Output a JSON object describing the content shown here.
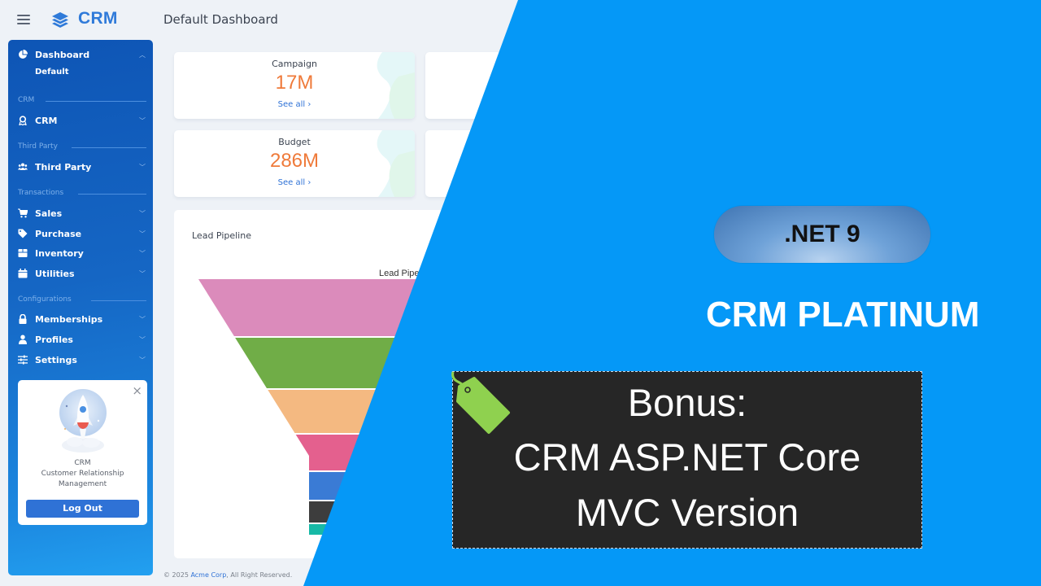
{
  "header": {
    "brand": "CRM",
    "page_title": "Default Dashboard"
  },
  "sidebar": {
    "dashboard": {
      "label": "Dashboard",
      "icon": "chart-pie-icon",
      "sub_items": [
        "Default"
      ]
    },
    "sections": [
      {
        "title": "CRM",
        "items": [
          {
            "label": "CRM",
            "icon": "award-icon"
          }
        ]
      },
      {
        "title": "Third Party",
        "items": [
          {
            "label": "Third Party",
            "icon": "users-icon"
          }
        ]
      },
      {
        "title": "Transactions",
        "items": [
          {
            "label": "Sales",
            "icon": "cart-icon"
          },
          {
            "label": "Purchase",
            "icon": "tag-icon"
          },
          {
            "label": "Inventory",
            "icon": "box-icon"
          },
          {
            "label": "Utilities",
            "icon": "calendar-icon"
          }
        ]
      },
      {
        "title": "Configurations",
        "items": [
          {
            "label": "Memberships",
            "icon": "lock-icon"
          },
          {
            "label": "Profiles",
            "icon": "user-icon"
          },
          {
            "label": "Settings",
            "icon": "sliders-icon"
          }
        ]
      }
    ],
    "promo": {
      "title": "CRM",
      "line1": "Customer Relationship",
      "line2": "Management",
      "logout_label": "Log Out",
      "close_glyph": "×"
    }
  },
  "cards": [
    {
      "title": "Campaign",
      "value": "17M",
      "link": "See all ›"
    },
    {
      "title": "Budget",
      "value": "286M",
      "link": "See all ›"
    }
  ],
  "pipeline": {
    "title": "Lead Pipeline",
    "chart_label": "Lead Pipe"
  },
  "chart_data": {
    "type": "funnel",
    "title": "Lead Pipeline",
    "stages": [
      {
        "color": "#db8bbb"
      },
      {
        "color": "#70ad47"
      },
      {
        "color": "#f4b981"
      },
      {
        "color": "#e4608e"
      },
      {
        "color": "#3a7bd5"
      },
      {
        "color": "#3d3d3d"
      },
      {
        "color": "#17b9a6"
      }
    ]
  },
  "footer": {
    "prefix": "© 2025 ",
    "company": "Acme Corp",
    "suffix": ", All Right Reserved."
  },
  "overlay": {
    "badge": ".NET 9",
    "headline": "CRM PLATINUM",
    "bonus_lines": [
      "Bonus:",
      "CRM ASP.NET Core",
      "MVC Version"
    ],
    "background_color": "#0598f7"
  }
}
